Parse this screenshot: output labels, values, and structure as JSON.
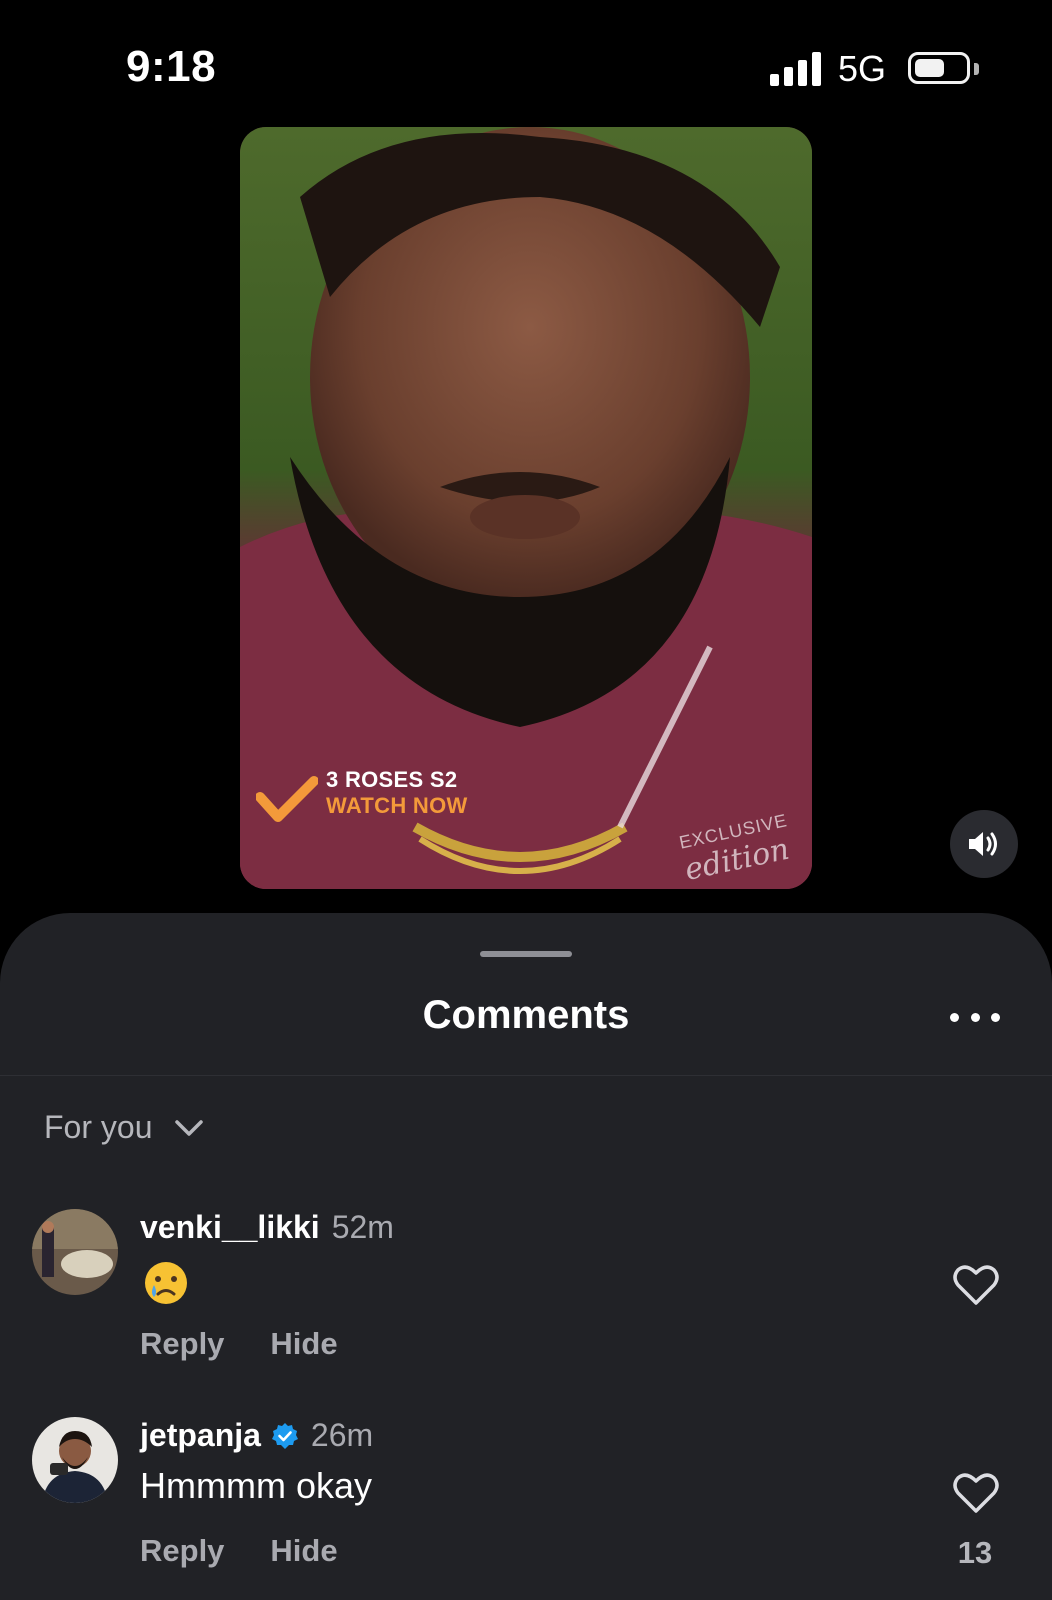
{
  "status_bar": {
    "time": "9:18",
    "network": "5G",
    "battery_level": 0.6
  },
  "video": {
    "title": "3 ROSES S2",
    "cta": "WATCH NOW",
    "brand_small": "EXCLUSIVE",
    "brand_script": "edition",
    "accent_color": "#f39a3a"
  },
  "sheet": {
    "title": "Comments",
    "sort_label": "For you"
  },
  "comments": [
    {
      "username": "venki__likki",
      "time": "52m",
      "text": "",
      "emoji": "crying-face",
      "reply_label": "Reply",
      "hide_label": "Hide",
      "likes": ""
    },
    {
      "username": "jetpanja",
      "verified": true,
      "time": "26m",
      "text": "Hmmmm okay",
      "reply_label": "Reply",
      "hide_label": "Hide",
      "likes": "13"
    }
  ],
  "colors": {
    "sheet_bg": "#212226",
    "verified_blue": "#1d9bf0"
  }
}
